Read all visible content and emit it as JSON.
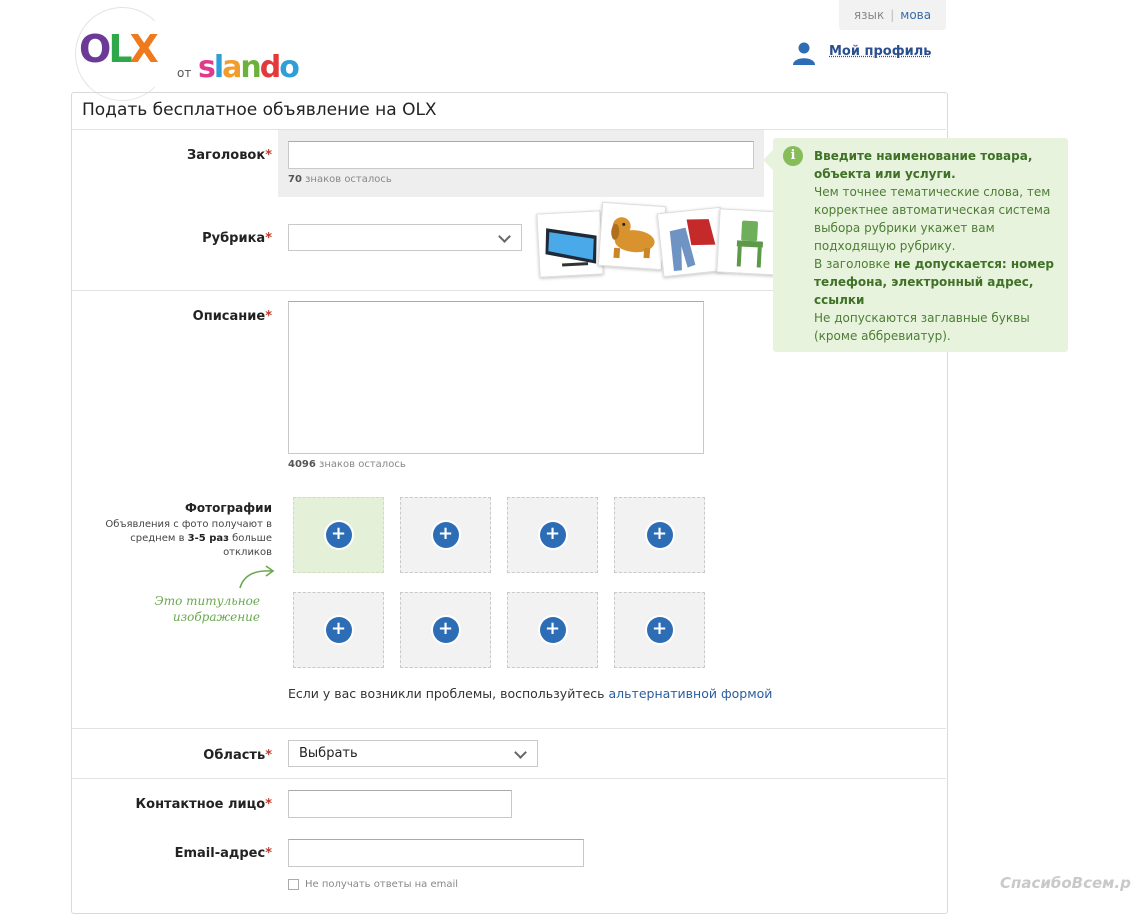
{
  "header": {
    "lang_label": "язык",
    "lang_separator": "|",
    "lang_link": "мова",
    "logo_olx": [
      "O",
      "L",
      "X"
    ],
    "logo_from": "от",
    "logo_slando": [
      "s",
      "l",
      "a",
      "n",
      "d",
      "o"
    ],
    "profile_label": "Мой профиль"
  },
  "form": {
    "title": "Подать бесплатное объявление на OLX",
    "required_mark": "*",
    "headline": {
      "label": "Заголовок",
      "value": "",
      "chars_left_num": "70",
      "chars_left_text": " знаков осталось"
    },
    "category": {
      "label": "Рубрика",
      "value": "",
      "thumbnails": [
        "tv-category-image",
        "dog-category-image",
        "clothes-category-image",
        "chair-category-image"
      ]
    },
    "description": {
      "label": "Описание",
      "value": "",
      "chars_left_num": "4096",
      "chars_left_text": " знаков осталось"
    },
    "photos": {
      "label": "Фотографии",
      "desc_1": "Объявления с фото получают в среднем в ",
      "desc_bold": "3-5 раз",
      "desc_2": " больше откликов",
      "title_image_note_1": "Это титульное",
      "title_image_note_2": "изображение",
      "add_symbol": "+",
      "problem_text": "Если у вас возникли проблемы, воспользуйтесь ",
      "problem_link": "альтернативной формой"
    },
    "region": {
      "label": "Область",
      "value": "Выбрать"
    },
    "contact": {
      "label": "Контактное лицо",
      "value": ""
    },
    "email": {
      "label": "Email-адрес",
      "value": "",
      "no_replies_label": "Не получать ответы на email"
    }
  },
  "tooltip": {
    "icon": "i",
    "line1_bold": "Введите наименование товара, объекта или услуги.",
    "line2": "Чем точнее тематические слова, тем корректнее автоматическая система выбора рубрики укажет вам подходящую рубрику.",
    "line3_pre": "В заголовке ",
    "line3_bold": "не допускается: номер телефона, электронный адрес, ссылки",
    "line4": "Не допускаются заглавные буквы (кроме аббревиатур)."
  },
  "watermark": "СпасибоВсем.ру",
  "colors": {
    "accent_blue": "#2d6db5",
    "link_blue": "#2a5d9f",
    "tip_bg": "#e8f3dd",
    "tip_text": "#4d7d35",
    "required_red": "#c0392b"
  }
}
